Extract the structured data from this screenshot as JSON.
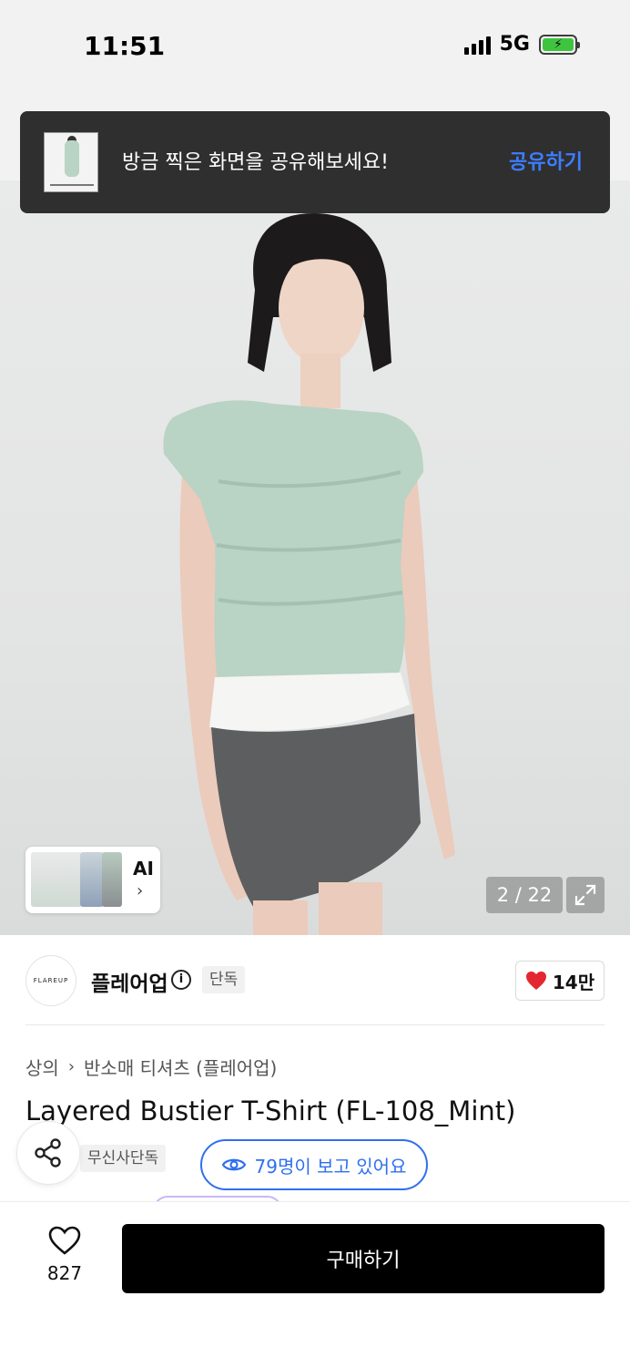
{
  "status_bar": {
    "time": "11:51",
    "network": "5G"
  },
  "toast": {
    "message": "방금 찍은 화면을 공유해보세요!",
    "action": "공유하기"
  },
  "gallery": {
    "current": "2 / 22",
    "ai_label": "AI",
    "ai_chevron": "›"
  },
  "brand": {
    "logo_text": "FLAREUP",
    "name": "플레어업",
    "info_glyph": "i",
    "badge": "단독",
    "likes": "14만"
  },
  "breadcrumb": {
    "category": "상의",
    "separator": "›",
    "subcategory": "반소매 티셔츠 (플레어업)"
  },
  "product": {
    "title": "Layered Bustier T-Shirt (FL-108_Mint)",
    "badge": "무신사단독",
    "viewers": "79명이 보고 있어요"
  },
  "bottom_bar": {
    "wishlist_count": "827",
    "buy_label": "구매하기"
  },
  "colors": {
    "accent_blue": "#2f6ff0",
    "heart_red": "#e3262f",
    "buy_black": "#000000",
    "mint": "#b9d3c4"
  },
  "icons": [
    "share-icon",
    "eye-icon",
    "heart-icon",
    "expand-icon",
    "info-icon",
    "chevron-right-icon"
  ]
}
